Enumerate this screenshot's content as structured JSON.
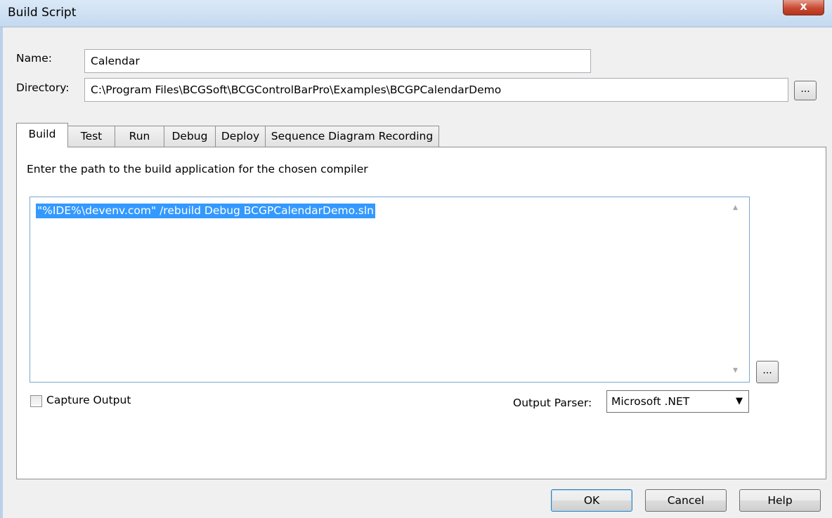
{
  "window": {
    "title": "Build Script",
    "close_label": "x"
  },
  "form": {
    "name_label": "Name:",
    "name_value": "Calendar",
    "directory_label": "Directory:",
    "directory_value": "C:\\Program Files\\BCGSoft\\BCGControlBarPro\\Examples\\BCGPCalendarDemo",
    "browse_label": "..."
  },
  "tabs": [
    {
      "label": "Build",
      "active": true
    },
    {
      "label": "Test"
    },
    {
      "label": "Run"
    },
    {
      "label": "Debug"
    },
    {
      "label": "Deploy"
    },
    {
      "label": "Sequence Diagram Recording"
    }
  ],
  "build": {
    "instruction": "Enter the path to the build application for the chosen compiler",
    "command": "\"%IDE%\\devenv.com\" /rebuild Debug BCGPCalendarDemo.sln",
    "browse_label": "...",
    "capture_output_label": "Capture Output",
    "capture_output_checked": false,
    "output_parser_label": "Output Parser:",
    "output_parser_value": "Microsoft .NET"
  },
  "buttons": {
    "ok": "OK",
    "cancel": "Cancel",
    "help": "Help"
  },
  "colors": {
    "selection": "#3399ff",
    "titlebar": "#c4d9ef",
    "close": "#c84a33"
  }
}
